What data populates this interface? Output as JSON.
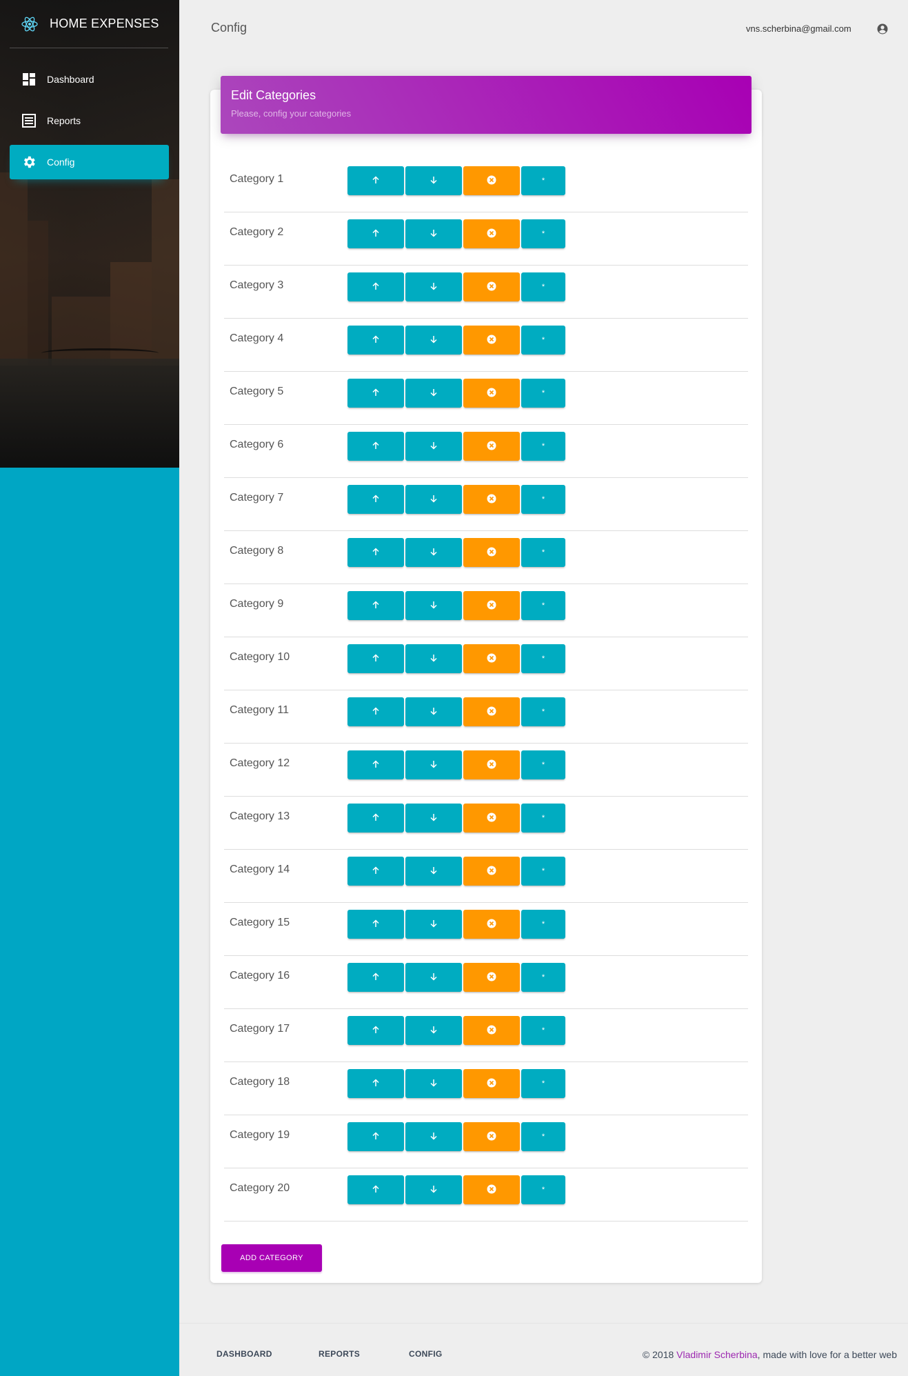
{
  "brand": {
    "title": "HOME EXPENSES"
  },
  "sidebar": {
    "items": [
      {
        "label": "Dashboard",
        "icon": "dashboard-icon",
        "active": false
      },
      {
        "label": "Reports",
        "icon": "reports-icon",
        "active": false
      },
      {
        "label": "Config",
        "icon": "gear-icon",
        "active": true
      }
    ]
  },
  "header": {
    "title": "Config",
    "user_email": "vns.scherbina@gmail.com",
    "user_icon": "account-circle-icon"
  },
  "card": {
    "title": "Edit Categories",
    "subtitle": "Please, config your categories",
    "categories": [
      "Category 1",
      "Category 2",
      "Category 3",
      "Category 4",
      "Category 5",
      "Category 6",
      "Category 7",
      "Category 8",
      "Category 9",
      "Category 10",
      "Category 11",
      "Category 12",
      "Category 13",
      "Category 14",
      "Category 15",
      "Category 16",
      "Category 17",
      "Category 18",
      "Category 19",
      "Category 20"
    ],
    "row_buttons": {
      "up_icon": "arrow-up-icon",
      "down_icon": "arrow-down-icon",
      "remove_icon": "cancel-icon",
      "star_label": "*"
    },
    "add_label": "ADD CATEGORY"
  },
  "footer": {
    "links": [
      "DASHBOARD",
      "REPORTS",
      "CONFIG"
    ],
    "copyright_prefix": "© 2018 ",
    "author": "Vladimir Scherbina",
    "copyright_suffix": ", made with love for a better web"
  },
  "colors": {
    "primary": "#00acc1",
    "warning": "#ff9800",
    "purple": "#a800b4",
    "sidebar": "#00a6c4"
  }
}
